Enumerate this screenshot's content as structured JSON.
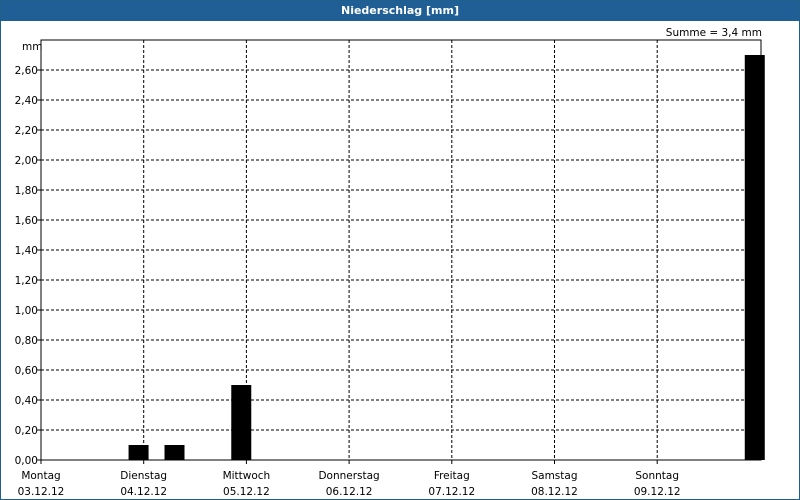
{
  "title": "Niederschlag [mm]",
  "summary": "Summe = 3,4 mm",
  "colors": {
    "title_bar": "#1f5f96",
    "bars": "#000000",
    "grid": "#000000",
    "background": "#ffffff"
  },
  "chart_data": {
    "type": "bar",
    "title": "Niederschlag [mm]",
    "ylabel": "mm",
    "xlabel": "",
    "ylim": [
      0,
      2.8
    ],
    "grid": true,
    "y_ticks": [
      "0,00",
      "0,20",
      "0,40",
      "0,60",
      "0,80",
      "1,00",
      "1,20",
      "1,40",
      "1,60",
      "1,80",
      "2,00",
      "2,20",
      "2,40",
      "2,60"
    ],
    "days": [
      {
        "weekday": "Montag",
        "date": "03.12.12"
      },
      {
        "weekday": "Dienstag",
        "date": "04.12.12"
      },
      {
        "weekday": "Mittwoch",
        "date": "05.12.12"
      },
      {
        "weekday": "Donnerstag",
        "date": "06.12.12"
      },
      {
        "weekday": "Freitag",
        "date": "07.12.12"
      },
      {
        "weekday": "Samstag",
        "date": "08.12.12"
      },
      {
        "weekday": "Sonntag",
        "date": "09.12.12"
      }
    ],
    "bars": [
      {
        "day_position": 0.95,
        "value": 0.1
      },
      {
        "day_position": 1.3,
        "value": 0.1
      },
      {
        "day_position": 1.95,
        "value": 0.5
      },
      {
        "day_position": 6.95,
        "value": 2.7
      }
    ],
    "summary": "Summe = 3,4 mm"
  }
}
